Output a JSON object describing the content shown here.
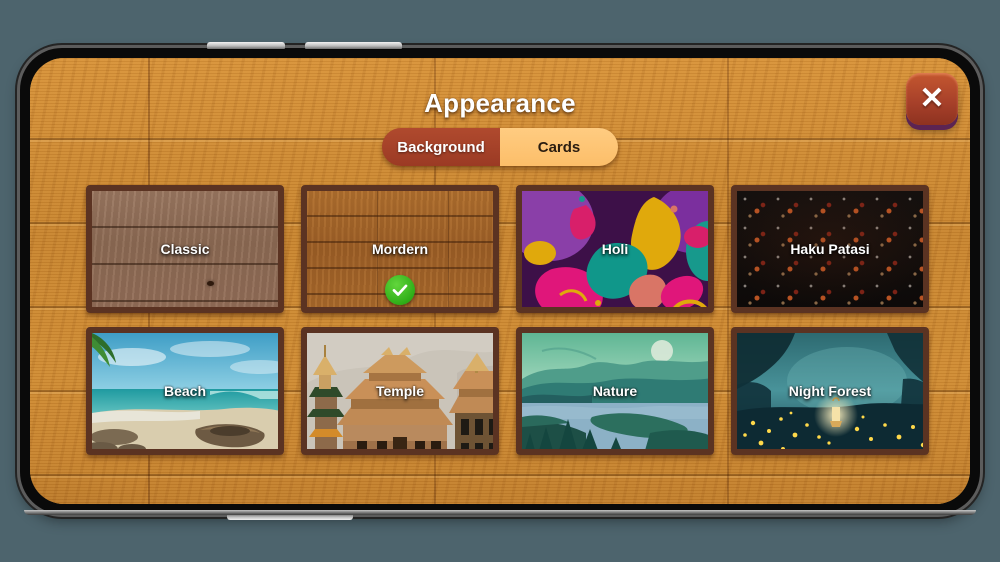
{
  "app": {
    "screen_title": "Appearance",
    "close_label": "✕",
    "close_icon": "close-x-icon"
  },
  "tabs": [
    {
      "label": "Background",
      "active": true
    },
    {
      "label": "Cards",
      "active": false
    }
  ],
  "colors": {
    "wood_bg": "#c6832d",
    "panel_border": "#5b3322",
    "tab_active_bg": "#a8412a",
    "tab_inactive_bg": "#fcbe69",
    "close_bg": "#a8412a",
    "check_green": "#2fae18",
    "title_text": "#ffffff"
  },
  "backgrounds": [
    {
      "label": "Classic",
      "selected": false,
      "art": "wood-grey-planks"
    },
    {
      "label": "Mordern",
      "selected": true,
      "art": "wood-orange-planks"
    },
    {
      "label": "Holi",
      "selected": false,
      "art": "abstract-color-petals"
    },
    {
      "label": "Haku Patasi",
      "selected": false,
      "art": "black-red-motif-grid"
    },
    {
      "label": "Beach",
      "selected": false,
      "art": "beach-boat-sea"
    },
    {
      "label": "Temple",
      "selected": false,
      "art": "nepali-pagoda-temple"
    },
    {
      "label": "Nature",
      "selected": false,
      "art": "teal-mountains-lake"
    },
    {
      "label": "Night Forest",
      "selected": false,
      "art": "misty-forest-fireflies"
    }
  ],
  "selected_background": "Mordern",
  "device": {
    "orientation": "landscape",
    "buttons": [
      "volume-up",
      "volume-down",
      "power"
    ]
  }
}
